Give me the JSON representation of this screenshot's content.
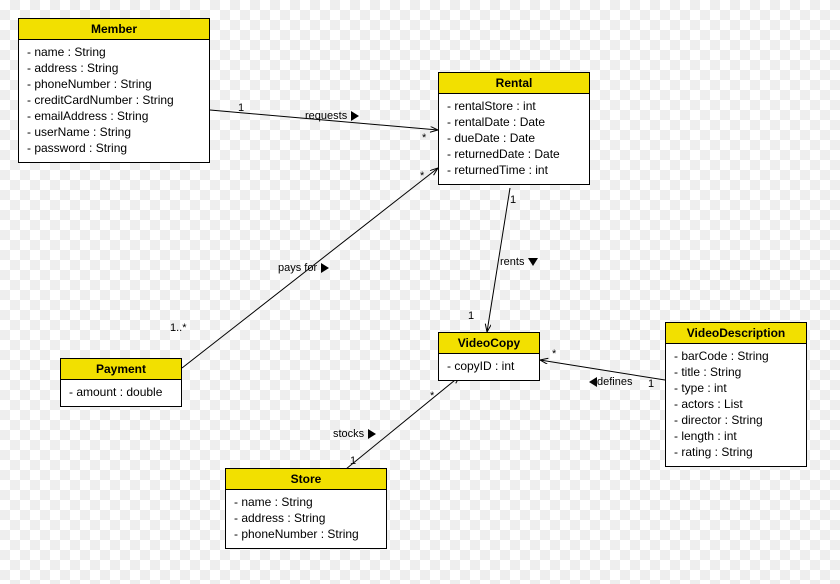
{
  "classes": {
    "member": {
      "name": "Member",
      "attrs": [
        "- name : String",
        "- address : String",
        "- phoneNumber : String",
        "- creditCardNumber : String",
        "- emailAddress : String",
        "- userName : String",
        "- password : String"
      ]
    },
    "rental": {
      "name": "Rental",
      "attrs": [
        "- rentalStore : int",
        "- rentalDate : Date",
        "- dueDate : Date",
        "- returnedDate : Date",
        "- returnedTime : int"
      ]
    },
    "payment": {
      "name": "Payment",
      "attrs": [
        "- amount : double"
      ]
    },
    "videocopy": {
      "name": "VideoCopy",
      "attrs": [
        "- copyID : int"
      ]
    },
    "store": {
      "name": "Store",
      "attrs": [
        "- name : String",
        "- address : String",
        "- phoneNumber : String"
      ]
    },
    "videodescription": {
      "name": "VideoDescription",
      "attrs": [
        "- barCode : String",
        "- title : String",
        "- type : int",
        "- actors : List",
        "- director : String",
        "- length : int",
        "- rating : String"
      ]
    }
  },
  "edges": {
    "requests": {
      "label": "requests",
      "mult_from": "1",
      "mult_to": "*"
    },
    "paysfor": {
      "label": "pays for",
      "mult_from": "1..*",
      "mult_to": "*"
    },
    "rents": {
      "label": "rents",
      "mult_from": "1",
      "mult_to": "1"
    },
    "defines": {
      "label": "defines",
      "mult_from": "*",
      "mult_to": "1"
    },
    "stocks": {
      "label": "stocks",
      "mult_from": "1",
      "mult_to": "*"
    }
  }
}
